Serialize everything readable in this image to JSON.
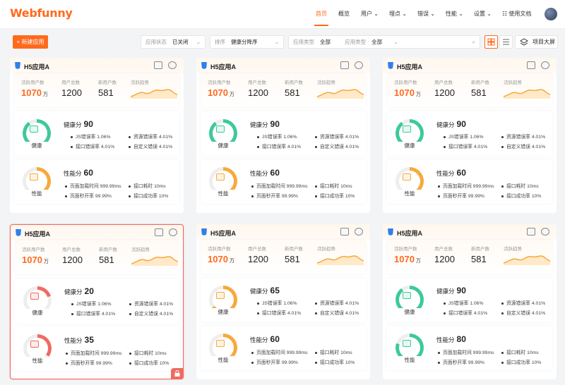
{
  "header": {
    "logo": "Webfunny",
    "nav": [
      {
        "label": "首页",
        "active": true
      },
      {
        "label": "概览"
      },
      {
        "label": "用户"
      },
      {
        "label": "埋点"
      },
      {
        "label": "错误"
      },
      {
        "label": "性能"
      },
      {
        "label": "设置"
      },
      {
        "label": "使用文档"
      }
    ]
  },
  "toolbar": {
    "new_app": "+ 新建应用",
    "filters": [
      {
        "label": "应用状态",
        "value": "已关闭"
      },
      {
        "label": "排序",
        "value": "健康分降序"
      },
      {
        "label": "应用类型",
        "value": "全部"
      },
      {
        "label": "应用类型",
        "value": "全部"
      }
    ],
    "bigscreen": "项目大屏"
  },
  "colors": {
    "accent": "#ff6a1e",
    "green": "#3ec99a",
    "orange": "#f7a93a",
    "red": "#f06a62"
  },
  "cards": [
    {
      "title": "H5应用A",
      "active_users_label": "活跃用户数",
      "active_users": "1070",
      "unit": "万",
      "total_users_label": "用户总数",
      "total_users": "1200",
      "new_users_label": "新用户数",
      "new_users": "581",
      "trend_label": "活跃趋势",
      "health": {
        "label": "健康分",
        "score": "90",
        "status": "健康",
        "status_color": "#3ec99a",
        "level": 0.9,
        "items": [
          "JS错误率 1.06%",
          "资源错误率 4.01%",
          "接口错误率 4.01%",
          "自定义错误 4.01%"
        ]
      },
      "perf": {
        "label": "性能分",
        "score": "60",
        "status": "性能",
        "status_color": "#f7a93a",
        "level": 0.6,
        "items": [
          "页面加载时间 999.99ms",
          "接口耗时 10ms",
          "页面秒开率 99.99%",
          "接口成功率 10%"
        ]
      }
    },
    {
      "title": "H5应用A",
      "active_users_label": "活跃用户数",
      "active_users": "1070",
      "unit": "万",
      "total_users_label": "用户总数",
      "total_users": "1200",
      "new_users_label": "新用户数",
      "new_users": "581",
      "trend_label": "活跃趋势",
      "health": {
        "label": "健康分",
        "score": "90",
        "status": "健康",
        "status_color": "#3ec99a",
        "level": 0.9,
        "items": [
          "JS错误率 1.06%",
          "资源错误率 4.01%",
          "接口错误率 4.01%",
          "自定义错误 4.01%"
        ]
      },
      "perf": {
        "label": "性能分",
        "score": "60",
        "status": "性能",
        "status_color": "#f7a93a",
        "level": 0.6,
        "items": [
          "页面加载时间 999.99ms",
          "接口耗时 10ms",
          "页面秒开率 99.99%",
          "接口成功率 10%"
        ]
      }
    },
    {
      "title": "H5应用A",
      "active_users_label": "活跃用户数",
      "active_users": "1070",
      "unit": "万",
      "total_users_label": "用户总数",
      "total_users": "1200",
      "new_users_label": "新用户数",
      "new_users": "581",
      "trend_label": "活跃趋势",
      "health": {
        "label": "健康分",
        "score": "90",
        "status": "健康",
        "status_color": "#3ec99a",
        "level": 0.9,
        "items": [
          "JS错误率 1.06%",
          "资源错误率 4.01%",
          "接口错误率 4.01%",
          "自定义错误 4.01%"
        ]
      },
      "perf": {
        "label": "性能分",
        "score": "60",
        "status": "性能",
        "status_color": "#f7a93a",
        "level": 0.6,
        "items": [
          "页面加载时间 999.99ms",
          "接口耗时 10ms",
          "页面秒开率 99.99%",
          "接口成功率 10%"
        ]
      }
    },
    {
      "title": "H5应用A",
      "active_users_label": "活跃用户数",
      "active_users": "1070",
      "unit": "万",
      "total_users_label": "用户总数",
      "total_users": "1200",
      "new_users_label": "新用户数",
      "new_users": "581",
      "trend_label": "活跃趋势",
      "health": {
        "label": "健康分",
        "score": "20",
        "status": "健康",
        "status_color": "#f06a62",
        "level": 0.2,
        "items": [
          "JS错误率 1.06%",
          "资源错误率 4.01%",
          "接口错误率 4.01%",
          "自定义错误 4.01%"
        ]
      },
      "perf": {
        "label": "性能分",
        "score": "35",
        "status": "性能",
        "status_color": "#f06a62",
        "level": 0.35,
        "items": [
          "页面加载时间 999.99ms",
          "接口耗时 10ms",
          "页面秒开率 99.99%",
          "接口成功率 10%"
        ]
      }
    },
    {
      "title": "H5应用A",
      "active_users_label": "活跃用户数",
      "active_users": "1070",
      "unit": "万",
      "total_users_label": "用户总数",
      "total_users": "1200",
      "new_users_label": "新用户数",
      "new_users": "581",
      "trend_label": "活跃趋势",
      "health": {
        "label": "健康分",
        "score": "65",
        "status": "健康",
        "status_color": "#f7a93a",
        "level": 0.65,
        "items": [
          "JS错误率 1.06%",
          "资源错误率 4.01%",
          "接口错误率 4.01%",
          "自定义错误 4.01%"
        ]
      },
      "perf": {
        "label": "性能分",
        "score": "60",
        "status": "性能",
        "status_color": "#f7a93a",
        "level": 0.6,
        "items": [
          "页面加载时间 999.99ms",
          "接口耗时 10ms",
          "页面秒开率 99.99%",
          "接口成功率 10%"
        ]
      }
    },
    {
      "title": "H5应用A",
      "active_users_label": "活跃用户数",
      "active_users": "1070",
      "unit": "万",
      "total_users_label": "用户总数",
      "total_users": "1200",
      "new_users_label": "新用户数",
      "new_users": "581",
      "trend_label": "活跃趋势",
      "health": {
        "label": "健康分",
        "score": "90",
        "status": "健康",
        "status_color": "#3ec99a",
        "level": 0.9,
        "items": [
          "JS错误率 1.06%",
          "资源错误率 4.01%",
          "接口错误率 4.01%",
          "自定义错误 4.01%"
        ]
      },
      "perf": {
        "label": "性能分",
        "score": "80",
        "status": "性能",
        "status_color": "#3ec99a",
        "level": 0.8,
        "items": [
          "页面加载时间 999.99ms",
          "接口耗时 10ms",
          "页面秒开率 99.99%",
          "接口成功率 10%"
        ]
      }
    }
  ]
}
